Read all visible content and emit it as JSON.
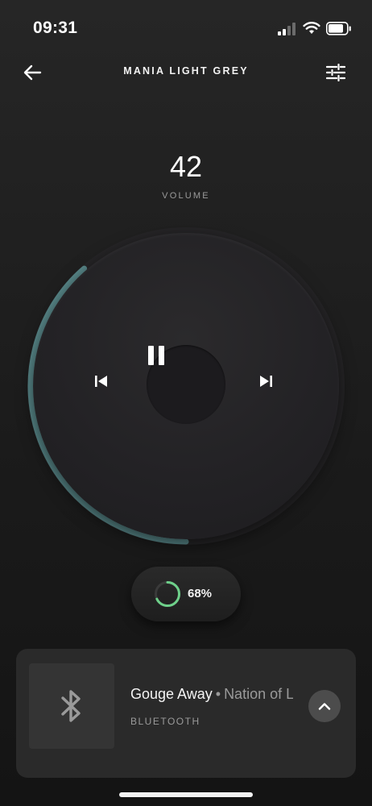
{
  "status_bar": {
    "time": "09:31",
    "icons": [
      "cellular-signal-icon",
      "wifi-icon",
      "battery-icon"
    ]
  },
  "header": {
    "title": "MANIA LIGHT GREY",
    "back_icon": "arrow-left-icon",
    "settings_icon": "sliders-icon"
  },
  "volume": {
    "value": "42",
    "label": "VOLUME",
    "level": 0.42
  },
  "controls": {
    "previous_icon": "skip-previous-icon",
    "pause_icon": "pause-icon",
    "next_icon": "skip-next-icon"
  },
  "battery": {
    "percent_label": "68%",
    "level": 0.68
  },
  "now_playing": {
    "title": "Gouge Away",
    "separator": "•",
    "artist": "Nation of Language",
    "source": "BLUETOOTH",
    "art_icon": "bluetooth-icon",
    "expand_icon": "chevron-up-icon"
  },
  "colors": {
    "background": "#1f1f1f",
    "volume_arc": "#5a8a8c",
    "battery_ring": "#6ed08a",
    "card": "#2a2a2a"
  }
}
